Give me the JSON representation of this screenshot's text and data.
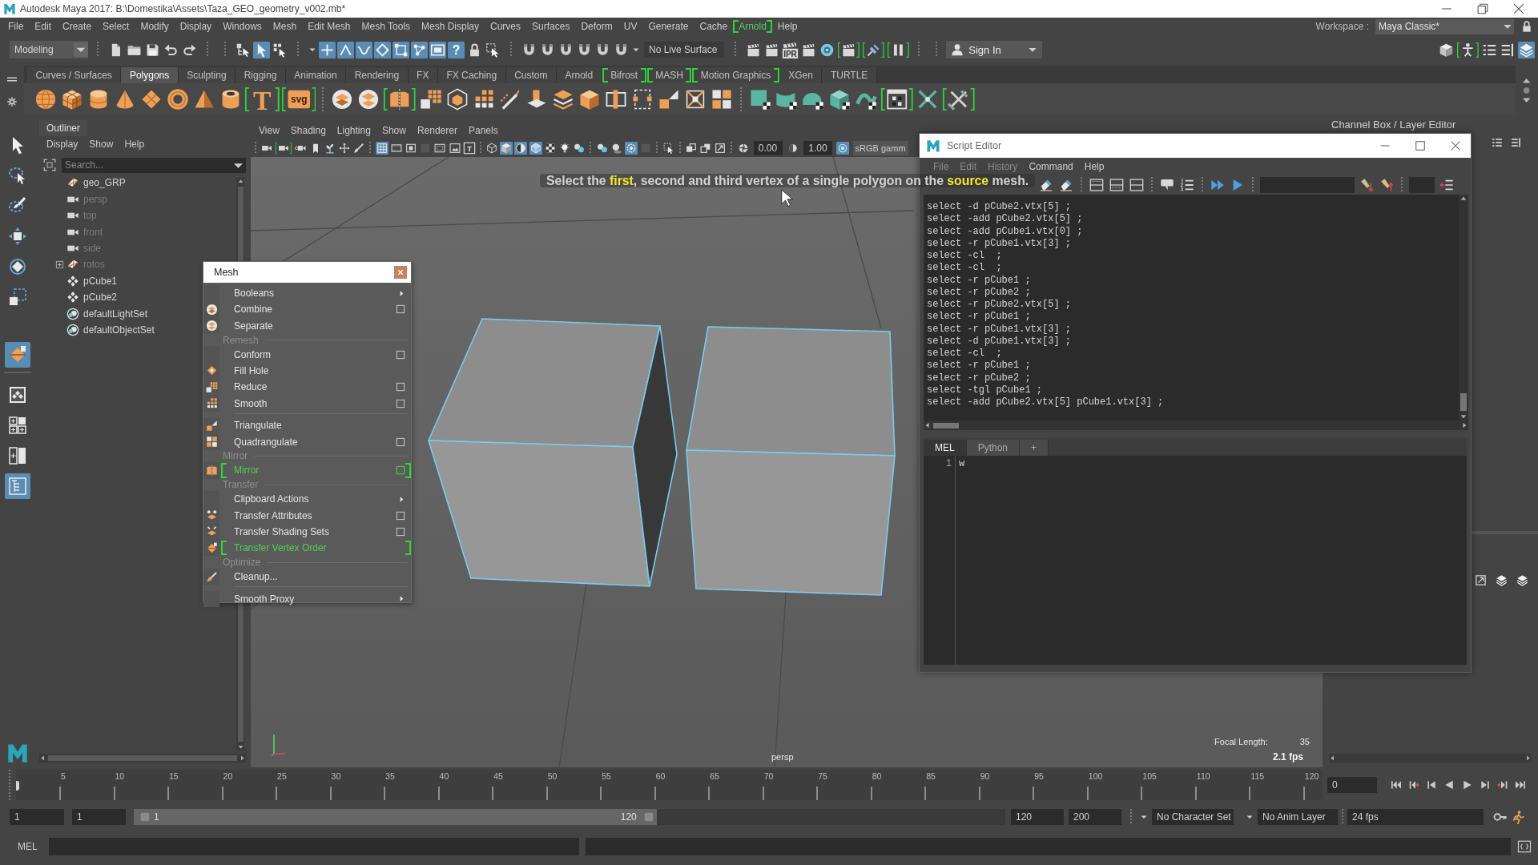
{
  "window": {
    "title": "Autodesk Maya 2017: B:\\Domestika\\Assets\\Taza_GEO_geometry_v002.mb*"
  },
  "menu_bar": {
    "items": [
      {
        "label": "File",
        "new": false
      },
      {
        "label": "Edit",
        "new": false
      },
      {
        "label": "Create",
        "new": false
      },
      {
        "label": "Select",
        "new": false
      },
      {
        "label": "Modify",
        "new": false
      },
      {
        "label": "Display",
        "new": false
      },
      {
        "label": "Windows",
        "new": false
      },
      {
        "label": "Mesh",
        "new": false
      },
      {
        "label": "Edit Mesh",
        "new": false
      },
      {
        "label": "Mesh Tools",
        "new": false
      },
      {
        "label": "Mesh Display",
        "new": false
      },
      {
        "label": "Curves",
        "new": false
      },
      {
        "label": "Surfaces",
        "new": false
      },
      {
        "label": "Deform",
        "new": false
      },
      {
        "label": "UV",
        "new": false
      },
      {
        "label": "Generate",
        "new": false
      },
      {
        "label": "Cache",
        "new": false
      },
      {
        "label": "Arnold",
        "new": true
      },
      {
        "label": "Help",
        "new": false
      }
    ],
    "workspace_label": "Workspace :",
    "workspace": "Maya Classic*"
  },
  "status_line": {
    "menu_set": "Modeling",
    "live_surface": "No Live Surface",
    "sign_in": "Sign In",
    "buttons": [
      {
        "on": false,
        "new": false
      },
      {
        "on": false,
        "new": false
      },
      {
        "on": false,
        "new": false
      },
      {
        "on": false,
        "new": false
      },
      {
        "on": false,
        "new": false
      },
      {
        "on": false,
        "new": false
      },
      {
        "on": true,
        "new": false
      },
      {
        "on": false,
        "new": false
      },
      {
        "on": true,
        "new": false
      },
      {
        "on": true,
        "new": false
      },
      {
        "on": true,
        "new": false
      },
      {
        "on": true,
        "new": false
      },
      {
        "on": true,
        "new": false
      },
      {
        "on": true,
        "new": false
      },
      {
        "on": true,
        "new": false
      },
      {
        "on": true,
        "new": false,
        "label": "?"
      },
      {
        "on": false,
        "new": false
      },
      {
        "on": false,
        "new": false
      },
      {
        "on": false,
        "new": false
      },
      {
        "on": false,
        "new": false
      },
      {
        "on": false,
        "new": false
      },
      {
        "on": false,
        "new": false
      },
      {
        "on": false,
        "new": false
      },
      {
        "on": false,
        "new": false
      },
      {
        "on": false,
        "new": false
      },
      {
        "on": false,
        "new": false
      },
      {
        "on": false,
        "new": false,
        "label": "IPR"
      },
      {
        "on": false,
        "new": false
      },
      {
        "on": false,
        "new": false
      },
      {
        "on": false,
        "new": true
      },
      {
        "on": false,
        "new": true
      },
      {
        "on": false,
        "new": true
      },
      {
        "on": false,
        "new": false
      },
      {
        "on": false,
        "new": true
      },
      {
        "on": false,
        "new": false
      },
      {
        "on": false,
        "new": false
      },
      {
        "on": true,
        "new": false
      }
    ]
  },
  "shelf": {
    "tabs": [
      {
        "label": "Curves / Surfaces",
        "selected": false,
        "new": false
      },
      {
        "label": "Polygons",
        "selected": true,
        "new": false
      },
      {
        "label": "Sculpting",
        "selected": false,
        "new": false
      },
      {
        "label": "Rigging",
        "selected": false,
        "new": false
      },
      {
        "label": "Animation",
        "selected": false,
        "new": false
      },
      {
        "label": "Rendering",
        "selected": false,
        "new": false
      },
      {
        "label": "FX",
        "selected": false,
        "new": false
      },
      {
        "label": "FX Caching",
        "selected": false,
        "new": false
      },
      {
        "label": "Custom",
        "selected": false,
        "new": false
      },
      {
        "label": "Arnold",
        "selected": false,
        "new": false
      },
      {
        "label": "Bifrost",
        "selected": false,
        "new": true
      },
      {
        "label": "MASH",
        "selected": false,
        "new": true
      },
      {
        "label": "Motion Graphics",
        "selected": false,
        "new": true
      },
      {
        "label": "XGen",
        "selected": false,
        "new": false
      },
      {
        "label": "TURTLE",
        "selected": false,
        "new": false
      }
    ],
    "buttons": [
      {
        "new": false
      },
      {
        "new": false
      },
      {
        "new": false
      },
      {
        "new": false
      },
      {
        "new": false
      },
      {
        "new": false
      },
      {
        "new": false
      },
      {
        "new": false
      },
      {
        "new": true,
        "label": "T"
      },
      {
        "new": true,
        "label": "svg"
      },
      {
        "new": false
      },
      {
        "new": false
      },
      {
        "new": true
      },
      {
        "new": false
      },
      {
        "new": false
      },
      {
        "new": false
      },
      {
        "new": false
      },
      {
        "new": false
      },
      {
        "new": false
      },
      {
        "new": false
      },
      {
        "new": false
      },
      {
        "new": false
      },
      {
        "new": false
      },
      {
        "new": false
      },
      {
        "new": false
      },
      {
        "new": false
      },
      {
        "new": false
      },
      {
        "new": false
      },
      {
        "new": false
      },
      {
        "new": false
      },
      {
        "new": true
      },
      {
        "new": false
      },
      {
        "new": true
      }
    ]
  },
  "toolbox": {
    "tools": [
      {
        "selected": false
      },
      {
        "selected": false
      },
      {
        "selected": false
      },
      {
        "selected": false
      },
      {
        "selected": false
      },
      {
        "selected": false
      },
      {
        "selected": true
      }
    ],
    "layouts": [
      {
        "selected": false
      },
      {
        "selected": false
      },
      {
        "selected": false
      },
      {
        "selected": true
      }
    ]
  },
  "outliner": {
    "title": "Outliner",
    "menus": [
      "Display",
      "Show",
      "Help"
    ],
    "search": {
      "placeholder": "Search..."
    },
    "items": [
      {
        "label": "geo_GRP",
        "kind": "group",
        "dimmed": false
      },
      {
        "label": "persp",
        "kind": "camera",
        "dimmed": true
      },
      {
        "label": "top",
        "kind": "camera",
        "dimmed": true
      },
      {
        "label": "front",
        "kind": "camera",
        "dimmed": true
      },
      {
        "label": "side",
        "kind": "camera",
        "dimmed": true
      },
      {
        "label": "rotos",
        "kind": "group",
        "dimmed": true,
        "expanded": false
      },
      {
        "label": "pCube1",
        "kind": "mesh",
        "dimmed": false
      },
      {
        "label": "pCube2",
        "kind": "mesh",
        "dimmed": false
      },
      {
        "label": "defaultLightSet",
        "kind": "set",
        "dimmed": false
      },
      {
        "label": "defaultObjectSet",
        "kind": "set",
        "dimmed": false
      }
    ]
  },
  "viewport": {
    "menus": [
      "View",
      "Shading",
      "Lighting",
      "Show",
      "Renderer",
      "Panels"
    ],
    "toolbar": {
      "buttons": [
        {
          "on": false,
          "new": false
        },
        {
          "on": false,
          "new": true
        },
        {
          "on": false,
          "new": false
        },
        {
          "on": false,
          "new": false
        },
        {
          "on": false,
          "new": false
        },
        {
          "on": false,
          "new": false
        },
        {
          "on": false,
          "new": false
        },
        {
          "on": true,
          "new": false
        },
        {
          "on": false,
          "new": false
        },
        {
          "on": false,
          "new": false
        },
        {
          "on": false,
          "new": false
        },
        {
          "on": false,
          "new": false
        },
        {
          "on": false,
          "new": false
        },
        {
          "on": false,
          "new": false,
          "label": "T"
        },
        {
          "on": false,
          "new": false
        },
        {
          "on": true,
          "new": false
        },
        {
          "on": true,
          "new": false
        },
        {
          "on": true,
          "new": false
        },
        {
          "on": false,
          "new": false
        },
        {
          "on": false,
          "new": false
        },
        {
          "on": false,
          "new": false
        },
        {
          "on": false,
          "new": false
        },
        {
          "on": false,
          "new": false
        },
        {
          "on": true,
          "new": false
        },
        {
          "on": false,
          "new": false
        },
        {
          "on": false,
          "new": false
        },
        {
          "on": false,
          "new": false
        },
        {
          "on": false,
          "new": false
        },
        {
          "on": false,
          "new": false
        },
        {
          "on": false,
          "new": false
        },
        {
          "on": false,
          "new": false
        },
        {
          "on": true,
          "new": false
        }
      ],
      "exposure": "0.00",
      "gamma": "1.00",
      "color_space": "sRGB gamm"
    },
    "hint": "Select the **first**, second and third vertex of a single polygon on the **source** mesh.",
    "camera": "persp",
    "focal_length_label": "Focal Length:",
    "focal_length": "35",
    "fps": "2.1 fps"
  },
  "channel_box": {
    "title": "Channel Box / Layer Editor"
  },
  "mesh_menu": {
    "title": "Mesh",
    "items": [
      {
        "kind": "item",
        "label": "Booleans",
        "option_box": false,
        "submenu": true,
        "new": false
      },
      {
        "kind": "item",
        "label": "Combine",
        "option_box": true,
        "submenu": false,
        "new": false
      },
      {
        "kind": "item",
        "label": "Separate",
        "option_box": false,
        "submenu": false,
        "new": false
      },
      {
        "kind": "header",
        "label": "Remesh"
      },
      {
        "kind": "item",
        "label": "Conform",
        "option_box": true,
        "submenu": false,
        "new": false
      },
      {
        "kind": "item",
        "label": "Fill Hole",
        "option_box": false,
        "submenu": false,
        "new": false
      },
      {
        "kind": "item",
        "label": "Reduce",
        "option_box": true,
        "submenu": false,
        "new": false
      },
      {
        "kind": "item",
        "label": "Smooth",
        "option_box": true,
        "submenu": false,
        "new": false
      },
      {
        "kind": "divider"
      },
      {
        "kind": "item",
        "label": "Triangulate",
        "option_box": false,
        "submenu": false,
        "new": false
      },
      {
        "kind": "item",
        "label": "Quadrangulate",
        "option_box": true,
        "submenu": false,
        "new": false
      },
      {
        "kind": "header",
        "label": "Mirror"
      },
      {
        "kind": "item",
        "label": "Mirror",
        "option_box": true,
        "submenu": false,
        "new": true
      },
      {
        "kind": "header",
        "label": "Transfer"
      },
      {
        "kind": "item",
        "label": "Clipboard Actions",
        "option_box": false,
        "submenu": true,
        "new": false
      },
      {
        "kind": "item",
        "label": "Transfer Attributes",
        "option_box": true,
        "submenu": false,
        "new": false
      },
      {
        "kind": "item",
        "label": "Transfer Shading Sets",
        "option_box": true,
        "submenu": false,
        "new": false
      },
      {
        "kind": "item",
        "label": "Transfer Vertex Order",
        "option_box": false,
        "submenu": false,
        "new": true
      },
      {
        "kind": "header",
        "label": "Optimize"
      },
      {
        "kind": "item",
        "label": "Cleanup...",
        "option_box": false,
        "submenu": false,
        "new": false
      },
      {
        "kind": "divider"
      },
      {
        "kind": "item",
        "label": "Smooth Proxy",
        "option_box": false,
        "submenu": true,
        "new": false
      }
    ]
  },
  "script_editor": {
    "title": "Script Editor",
    "menus": [
      {
        "label": "File",
        "dimmed": true
      },
      {
        "label": "Edit",
        "dimmed": true
      },
      {
        "label": "History",
        "dimmed": true
      },
      {
        "label": "Command",
        "dimmed": false
      },
      {
        "label": "Help",
        "dimmed": false
      }
    ],
    "output": [
      "select -d pCube2.vtx[5] ;",
      "select -add pCube2.vtx[5] ;",
      "select -add pCube1.vtx[0] ;",
      "select -r pCube1.vtx[3] ;",
      "select -cl  ;",
      "select -cl  ;",
      "select -r pCube1 ;",
      "select -r pCube2 ;",
      "select -r pCube2.vtx[5] ;",
      "select -r pCube1 ;",
      "select -r pCube1.vtx[3] ;",
      "select -d pCube1.vtx[3] ;",
      "select -cl  ;",
      "select -r pCube1 ;",
      "select -r pCube2 ;",
      "select -tgl pCube1 ;",
      "select -add pCube2.vtx[5] pCube1.vtx[3] ;"
    ],
    "tabs": [
      {
        "label": "MEL",
        "selected": true
      },
      {
        "label": "Python",
        "selected": false
      }
    ],
    "add_tab": "+",
    "input": {
      "line_number": "1",
      "value": "w"
    }
  },
  "time_slider": {
    "ticks": [
      "5",
      "10",
      "15",
      "20",
      "25",
      "30",
      "35",
      "40",
      "45",
      "50",
      "55",
      "60",
      "65",
      "70",
      "75",
      "80",
      "85",
      "90",
      "95",
      "100",
      "105",
      "110",
      "115",
      "120"
    ],
    "level": 0,
    "current_frame": "0"
  },
  "range_slider": {
    "start": "1",
    "playback_start": "1",
    "range_start": "1",
    "range_end": "120",
    "level": 0.6,
    "playback_end": "120",
    "end": "200",
    "character_set": "No Character Set",
    "anim_layer": "No Anim Layer",
    "fps": "24 fps"
  },
  "command_line": {
    "language": "MEL"
  }
}
